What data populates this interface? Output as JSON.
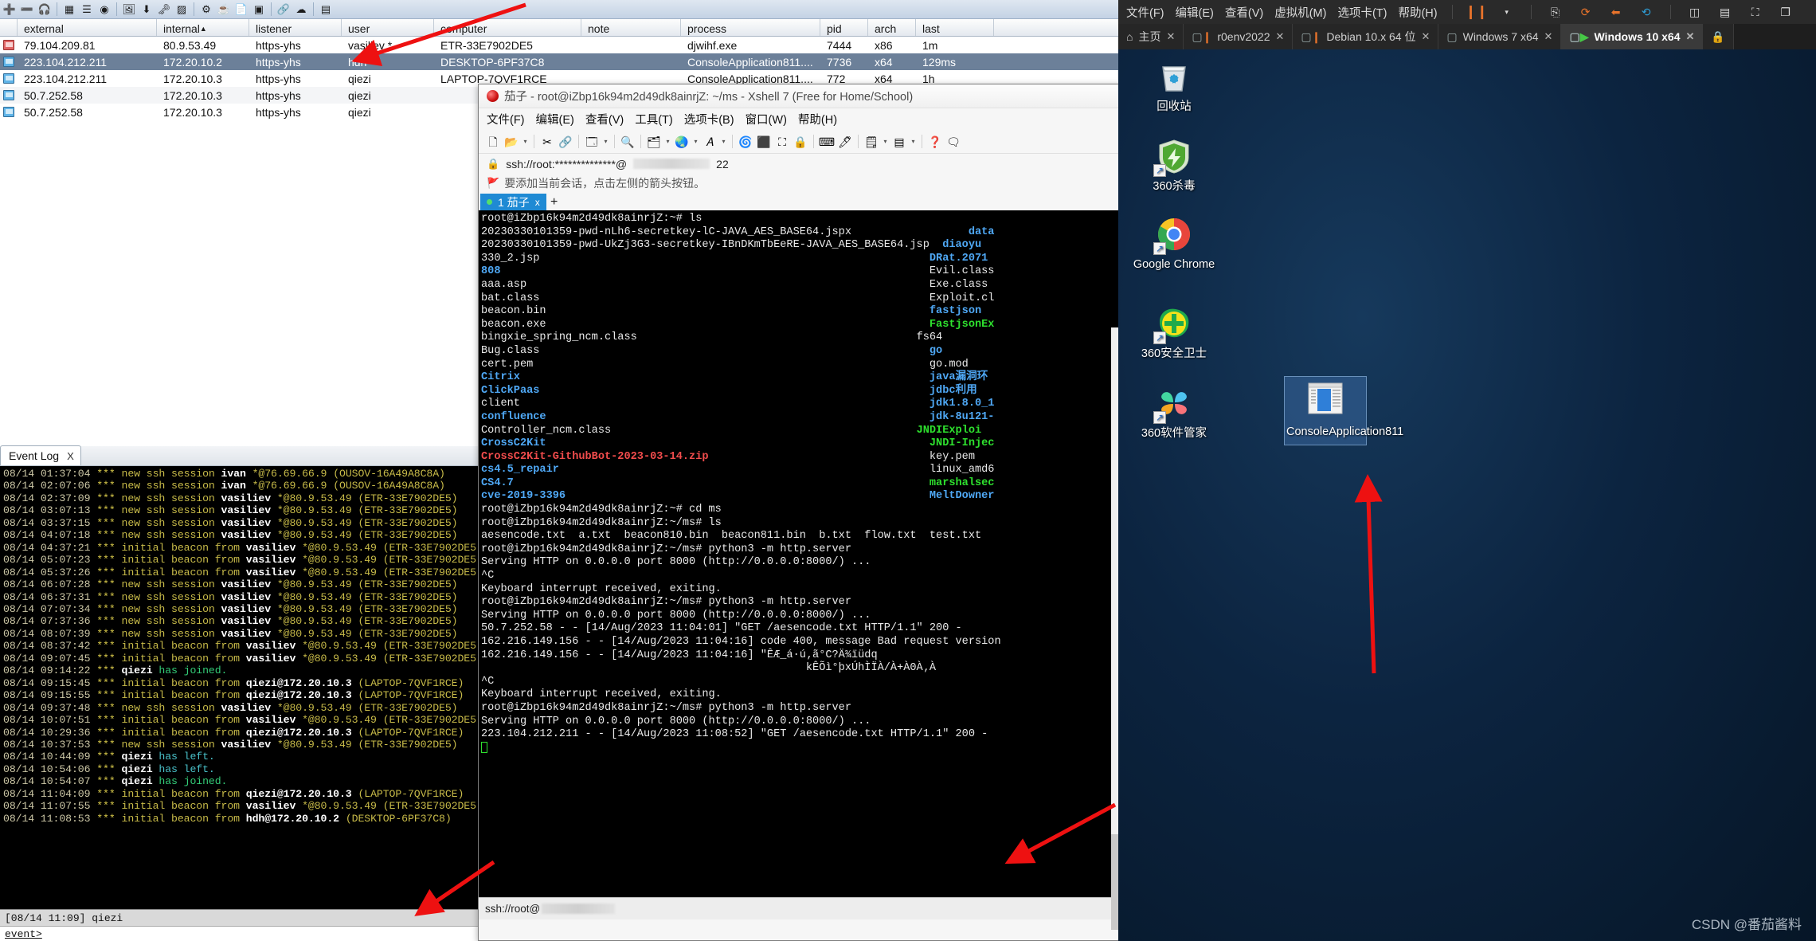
{
  "cobalt_strike": {
    "toolbar_icons": [
      "new-connection-icon",
      "disconnect-icon",
      "listeners-icon",
      "change-view-icon",
      "targets-icon",
      "crosshair-icon",
      "payload-icon",
      "download-icon",
      "credentials-icon",
      "screenshot-icon",
      "settings-icon",
      "java-icon",
      "script-icon",
      "console-icon",
      "link-icon",
      "cloud-icon",
      "help-icon"
    ],
    "table": {
      "columns": [
        "external",
        "internal",
        "listener",
        "user",
        "computer",
        "note",
        "process",
        "pid",
        "arch",
        "last"
      ],
      "sort_column": "internal",
      "rows": [
        {
          "external": "79.104.209.81",
          "internal": "80.9.53.49",
          "listener": "https-yhs",
          "user": "vasiliev *",
          "computer": "ETR-33E7902DE5",
          "note": "",
          "process": "djwihf.exe",
          "pid": "7444",
          "arch": "x86",
          "last": "1m",
          "icon": "beacon-red",
          "selected": false
        },
        {
          "external": "223.104.212.211",
          "internal": "172.20.10.2",
          "listener": "https-yhs",
          "user": "hdh",
          "computer": "DESKTOP-6PF37C8",
          "note": "",
          "process": "ConsoleApplication811....",
          "pid": "7736",
          "arch": "x64",
          "last": "129ms",
          "icon": "beacon-blue",
          "selected": true
        },
        {
          "external": "223.104.212.211",
          "internal": "172.20.10.3",
          "listener": "https-yhs",
          "user": "qiezi",
          "computer": "LAPTOP-7QVF1RCE",
          "note": "",
          "process": "ConsoleApplication811....",
          "pid": "772",
          "arch": "x64",
          "last": "1h",
          "icon": "beacon-blue",
          "selected": false
        },
        {
          "external": "50.7.252.58",
          "internal": "172.20.10.3",
          "listener": "https-yhs",
          "user": "qiezi",
          "computer": "",
          "note": "",
          "process": "",
          "pid": "",
          "arch": "",
          "last": "",
          "icon": "beacon-blue",
          "selected": false
        },
        {
          "external": "50.7.252.58",
          "internal": "172.20.10.3",
          "listener": "https-yhs",
          "user": "qiezi",
          "computer": "",
          "note": "",
          "process": "",
          "pid": "",
          "arch": "",
          "last": "",
          "icon": "beacon-blue",
          "selected": false
        }
      ]
    },
    "event_log": {
      "tab_label": "Event Log",
      "tab_close": "X",
      "lines": [
        {
          "ts": "08/14 01:37:04",
          "stars": "***",
          "text": " new ssh session ",
          "name": "ivan",
          "rest": " *@76.69.66.9 (OUSOV-16A49A8C8A)",
          "kind": "beacon"
        },
        {
          "ts": "08/14 02:07:06",
          "stars": "***",
          "text": " new ssh session ",
          "name": "ivan",
          "rest": " *@76.69.66.9 (OUSOV-16A49A8C8A)",
          "kind": "beacon"
        },
        {
          "ts": "08/14 02:37:09",
          "stars": "***",
          "text": " new ssh session ",
          "name": "vasiliev",
          "rest": " *@80.9.53.49 (ETR-33E7902DE5)",
          "kind": "beacon"
        },
        {
          "ts": "08/14 03:07:13",
          "stars": "***",
          "text": " new ssh session ",
          "name": "vasiliev",
          "rest": " *@80.9.53.49 (ETR-33E7902DE5)",
          "kind": "beacon"
        },
        {
          "ts": "08/14 03:37:15",
          "stars": "***",
          "text": " new ssh session ",
          "name": "vasiliev",
          "rest": " *@80.9.53.49 (ETR-33E7902DE5)",
          "kind": "beacon"
        },
        {
          "ts": "08/14 04:07:18",
          "stars": "***",
          "text": " new ssh session ",
          "name": "vasiliev",
          "rest": " *@80.9.53.49 (ETR-33E7902DE5)",
          "kind": "beacon"
        },
        {
          "ts": "08/14 04:37:21",
          "stars": "***",
          "text": " initial beacon from ",
          "name": "vasiliev",
          "rest": " *@80.9.53.49 (ETR-33E7902DE5)",
          "kind": "beacon"
        },
        {
          "ts": "08/14 05:07:23",
          "stars": "***",
          "text": " initial beacon from ",
          "name": "vasiliev",
          "rest": " *@80.9.53.49 (ETR-33E7902DE5)",
          "kind": "beacon"
        },
        {
          "ts": "08/14 05:37:26",
          "stars": "***",
          "text": " initial beacon from ",
          "name": "vasiliev",
          "rest": " *@80.9.53.49 (ETR-33E7902DE5)",
          "kind": "beacon"
        },
        {
          "ts": "08/14 06:07:28",
          "stars": "***",
          "text": " new ssh session ",
          "name": "vasiliev",
          "rest": " *@80.9.53.49 (ETR-33E7902DE5)",
          "kind": "beacon"
        },
        {
          "ts": "08/14 06:37:31",
          "stars": "***",
          "text": " new ssh session ",
          "name": "vasiliev",
          "rest": " *@80.9.53.49 (ETR-33E7902DE5)",
          "kind": "beacon"
        },
        {
          "ts": "08/14 07:07:34",
          "stars": "***",
          "text": " new ssh session ",
          "name": "vasiliev",
          "rest": " *@80.9.53.49 (ETR-33E7902DE5)",
          "kind": "beacon"
        },
        {
          "ts": "08/14 07:37:36",
          "stars": "***",
          "text": " new ssh session ",
          "name": "vasiliev",
          "rest": " *@80.9.53.49 (ETR-33E7902DE5)",
          "kind": "beacon"
        },
        {
          "ts": "08/14 08:07:39",
          "stars": "***",
          "text": " new ssh session ",
          "name": "vasiliev",
          "rest": " *@80.9.53.49 (ETR-33E7902DE5)",
          "kind": "beacon"
        },
        {
          "ts": "08/14 08:37:42",
          "stars": "***",
          "text": " initial beacon from ",
          "name": "vasiliev",
          "rest": " *@80.9.53.49 (ETR-33E7902DE5)",
          "kind": "beacon"
        },
        {
          "ts": "08/14 09:07:45",
          "stars": "***",
          "text": " initial beacon from ",
          "name": "vasiliev",
          "rest": " *@80.9.53.49 (ETR-33E7902DE5)",
          "kind": "beacon"
        },
        {
          "ts": "08/14 09:14:22",
          "stars": "***",
          "text": " ",
          "name": "qiezi",
          "rest": " has joined.",
          "kind": "join"
        },
        {
          "ts": "08/14 09:15:45",
          "stars": "***",
          "text": " initial beacon from ",
          "name": "qiezi@172.20.10.3",
          "rest": " (LAPTOP-7QVF1RCE)",
          "kind": "beacon"
        },
        {
          "ts": "08/14 09:15:55",
          "stars": "***",
          "text": " initial beacon from ",
          "name": "qiezi@172.20.10.3",
          "rest": " (LAPTOP-7QVF1RCE)",
          "kind": "beacon"
        },
        {
          "ts": "08/14 09:37:48",
          "stars": "***",
          "text": " new ssh session ",
          "name": "vasiliev",
          "rest": " *@80.9.53.49 (ETR-33E7902DE5)",
          "kind": "beacon"
        },
        {
          "ts": "08/14 10:07:51",
          "stars": "***",
          "text": " initial beacon from ",
          "name": "vasiliev",
          "rest": " *@80.9.53.49 (ETR-33E7902DE5)",
          "kind": "beacon"
        },
        {
          "ts": "08/14 10:29:36",
          "stars": "***",
          "text": " initial beacon from ",
          "name": "qiezi@172.20.10.3",
          "rest": " (LAPTOP-7QVF1RCE)",
          "kind": "beacon"
        },
        {
          "ts": "08/14 10:37:53",
          "stars": "***",
          "text": " new ssh session ",
          "name": "vasiliev",
          "rest": " *@80.9.53.49 (ETR-33E7902DE5)",
          "kind": "beacon"
        },
        {
          "ts": "08/14 10:44:09",
          "stars": "***",
          "text": " ",
          "name": "qiezi",
          "rest": " has left.",
          "kind": "left"
        },
        {
          "ts": "08/14 10:54:06",
          "stars": "***",
          "text": " ",
          "name": "qiezi",
          "rest": " has left.",
          "kind": "left"
        },
        {
          "ts": "08/14 10:54:07",
          "stars": "***",
          "text": " ",
          "name": "qiezi",
          "rest": " has joined.",
          "kind": "join"
        },
        {
          "ts": "08/14 11:04:09",
          "stars": "***",
          "text": " initial beacon from ",
          "name": "qiezi@172.20.10.3",
          "rest": " (LAPTOP-7QVF1RCE)",
          "kind": "beacon"
        },
        {
          "ts": "08/14 11:07:55",
          "stars": "***",
          "text": " initial beacon from ",
          "name": "vasiliev",
          "rest": " *@80.9.53.49 (ETR-33E7902DE5)",
          "kind": "beacon"
        },
        {
          "ts": "08/14 11:08:53",
          "stars": "***",
          "text": " initial beacon from ",
          "name": "hdh@172.20.10.2",
          "rest": " (DESKTOP-6PF37C8)",
          "kind": "beacon"
        }
      ],
      "status_line": "[08/14 11:09] qiezi",
      "prompt": "event>"
    }
  },
  "xshell": {
    "title": "茄子 - root@iZbp16k94m2d49dk8ainrjZ: ~/ms - Xshell 7 (Free for Home/School)",
    "menu": [
      "文件(F)",
      "编辑(E)",
      "查看(V)",
      "工具(T)",
      "选项卡(B)",
      "窗口(W)",
      "帮助(H)"
    ],
    "address_prefix": "ssh://root:**************@",
    "address_port": "22",
    "hint": "要添加当前会话，点击左侧的箭头按钮。",
    "tab_label": "1 茄子",
    "tab_close": "x",
    "new_tab": "+",
    "status_prefix": "ssh://root@",
    "terminal": [
      [
        {
          "t": "root@iZbp16k94m2d49dk8ainrjZ:~# ls",
          "c": "w"
        }
      ],
      [
        {
          "t": "20230330101359-pwd-nLh6-secretkey-lC-JAVA_AES_BASE64.jspx",
          "c": "w"
        },
        {
          "t": "                  ",
          "c": "w"
        },
        {
          "t": "data",
          "c": "b"
        }
      ],
      [
        {
          "t": "20230330101359-pwd-UkZj3G3-secretkey-IBnDKmTbEeRE-JAVA_AES_BASE64.jsp",
          "c": "w"
        },
        {
          "t": "  ",
          "c": "w"
        },
        {
          "t": "diaoyu",
          "c": "b"
        }
      ],
      [
        {
          "t": "330_2.jsp",
          "c": "w"
        },
        {
          "t": "                                                            ",
          "c": "w"
        },
        {
          "t": "DRat.2071",
          "c": "b"
        }
      ],
      [
        {
          "t": "808",
          "c": "b"
        },
        {
          "t": "                                                                  ",
          "c": "w"
        },
        {
          "t": "Evil.class",
          "c": "w"
        }
      ],
      [
        {
          "t": "aaa.asp",
          "c": "w"
        },
        {
          "t": "                                                              ",
          "c": "w"
        },
        {
          "t": "Exe.class",
          "c": "w"
        }
      ],
      [
        {
          "t": "bat.class",
          "c": "w"
        },
        {
          "t": "                                                            ",
          "c": "w"
        },
        {
          "t": "Exploit.cl",
          "c": "w"
        }
      ],
      [
        {
          "t": "beacon.bin",
          "c": "w"
        },
        {
          "t": "                                                           ",
          "c": "w"
        },
        {
          "t": "fastjson",
          "c": "b"
        }
      ],
      [
        {
          "t": "beacon.exe",
          "c": "w"
        },
        {
          "t": "                                                           ",
          "c": "w"
        },
        {
          "t": "FastjsonEx",
          "c": "g"
        }
      ],
      [
        {
          "t": "bingxie_spring_ncm.class",
          "c": "w"
        },
        {
          "t": "                                           ",
          "c": "w"
        },
        {
          "t": "fs64",
          "c": "w"
        }
      ],
      [
        {
          "t": "Bug.class",
          "c": "w"
        },
        {
          "t": "                                                            ",
          "c": "w"
        },
        {
          "t": "go",
          "c": "b"
        }
      ],
      [
        {
          "t": "cert.pem",
          "c": "w"
        },
        {
          "t": "                                                             ",
          "c": "w"
        },
        {
          "t": "go.mod",
          "c": "w"
        }
      ],
      [
        {
          "t": "Citrix",
          "c": "b"
        },
        {
          "t": "                                                               ",
          "c": "w"
        },
        {
          "t": "java漏洞环",
          "c": "b"
        }
      ],
      [
        {
          "t": "ClickPaas",
          "c": "b"
        },
        {
          "t": "                                                            ",
          "c": "w"
        },
        {
          "t": "jdbc利用",
          "c": "b"
        }
      ],
      [
        {
          "t": "client",
          "c": "w"
        },
        {
          "t": "                                                               ",
          "c": "w"
        },
        {
          "t": "jdk1.8.0_1",
          "c": "b"
        }
      ],
      [
        {
          "t": "confluence",
          "c": "b"
        },
        {
          "t": "                                                           ",
          "c": "w"
        },
        {
          "t": "jdk-8u121-",
          "c": "b"
        }
      ],
      [
        {
          "t": "Controller_ncm.class",
          "c": "w"
        },
        {
          "t": "                                               ",
          "c": "w"
        },
        {
          "t": "JNDIExploi",
          "c": "g"
        }
      ],
      [
        {
          "t": "CrossC2Kit",
          "c": "b"
        },
        {
          "t": "                                                           ",
          "c": "w"
        },
        {
          "t": "JNDI-Injec",
          "c": "g"
        }
      ],
      [
        {
          "t": "CrossC2Kit-GithubBot-2023-03-14.zip",
          "c": "r"
        },
        {
          "t": "                                  ",
          "c": "w"
        },
        {
          "t": "key.pem",
          "c": "w"
        }
      ],
      [
        {
          "t": "cs4.5_repair",
          "c": "b"
        },
        {
          "t": "                                                         ",
          "c": "w"
        },
        {
          "t": "linux_amd6",
          "c": "w"
        }
      ],
      [
        {
          "t": "CS4.7",
          "c": "b"
        },
        {
          "t": "                                                                ",
          "c": "w"
        },
        {
          "t": "marshalsec",
          "c": "g"
        }
      ],
      [
        {
          "t": "cve-2019-3396",
          "c": "b"
        },
        {
          "t": "                                                        ",
          "c": "w"
        },
        {
          "t": "MeltDowner",
          "c": "b"
        }
      ],
      [
        {
          "t": "root@iZbp16k94m2d49dk8ainrjZ:~# cd ms",
          "c": "w"
        }
      ],
      [
        {
          "t": "root@iZbp16k94m2d49dk8ainrjZ:~/ms# ls",
          "c": "w"
        }
      ],
      [
        {
          "t": "aesencode.txt  a.txt  beacon810.bin  beacon811.bin  b.txt  flow.txt  test.txt",
          "c": "w"
        }
      ],
      [
        {
          "t": "root@iZbp16k94m2d49dk8ainrjZ:~/ms# python3 -m http.server",
          "c": "w"
        }
      ],
      [
        {
          "t": "Serving HTTP on 0.0.0.0 port 8000 (http://0.0.0.0:8000/) ...",
          "c": "w"
        }
      ],
      [
        {
          "t": "^C",
          "c": "w"
        }
      ],
      [
        {
          "t": "Keyboard interrupt received, exiting.",
          "c": "w"
        }
      ],
      [
        {
          "t": "root@iZbp16k94m2d49dk8ainrjZ:~/ms# python3 -m http.server",
          "c": "w"
        }
      ],
      [
        {
          "t": "Serving HTTP on 0.0.0.0 port 8000 (http://0.0.0.0:8000/) ...",
          "c": "w"
        }
      ],
      [
        {
          "t": "50.7.252.58 - - [14/Aug/2023 11:04:01] \"GET /aesencode.txt HTTP/1.1\" 200 -",
          "c": "w"
        }
      ],
      [
        {
          "t": "162.216.149.156 - - [14/Aug/2023 11:04:16] code 400, message Bad request version",
          "c": "w"
        }
      ],
      [
        {
          "t": "162.216.149.156 - - [14/Aug/2023 11:04:16] \"ÊÆ_á·ú‚ã°C?Ä¾ïüdq",
          "c": "w"
        }
      ],
      [
        {
          "t": "                                                  kÊÕì°þxÚhÌÏÀ/À+À0À‚À",
          "c": "w"
        }
      ],
      [
        {
          "t": "^C",
          "c": "w"
        }
      ],
      [
        {
          "t": "Keyboard interrupt received, exiting.",
          "c": "w"
        }
      ],
      [
        {
          "t": "root@iZbp16k94m2d49dk8ainrjZ:~/ms# python3 -m http.server",
          "c": "w"
        }
      ],
      [
        {
          "t": "Serving HTTP on 0.0.0.0 port 8000 (http://0.0.0.0:8000/) ...",
          "c": "w"
        }
      ],
      [
        {
          "t": "223.104.212.211 - - [14/Aug/2023 11:08:52] \"GET /aesencode.txt HTTP/1.1\" 200 -",
          "c": "w"
        }
      ]
    ]
  },
  "vmware": {
    "menu": [
      "文件(F)",
      "编辑(E)",
      "查看(V)",
      "虚拟机(M)",
      "选项卡(T)",
      "帮助(H)"
    ],
    "toolbar_icons": [
      "pause-icon",
      "dropdown-caret-icon",
      "snapshot-icon",
      "snapshot-take-icon",
      "snapshot-revert-icon",
      "snapshot-manager-icon",
      "layout-a-icon",
      "layout-b-icon",
      "layout-c-icon",
      "layout-d-icon",
      "fullscreen-icon",
      "unity-icon"
    ],
    "tabs": [
      {
        "label": "主页",
        "icon": "home-icon",
        "active": false
      },
      {
        "label": "r0env2022",
        "icon": "vm-paused-icon",
        "active": false
      },
      {
        "label": "Debian 10.x 64 位",
        "icon": "vm-paused-icon",
        "active": false
      },
      {
        "label": "Windows 7 x64",
        "icon": "vm-stopped-icon",
        "active": false
      },
      {
        "label": "Windows 10 x64",
        "icon": "vm-running-icon",
        "active": true
      }
    ],
    "desktop_icons": [
      {
        "label": "回收站",
        "icon": "recycle-bin-icon",
        "shortcut": false,
        "selected": false
      },
      {
        "label": "360杀毒",
        "icon": "360-antivirus-icon",
        "shortcut": true,
        "selected": false
      },
      {
        "label": "Google Chrome",
        "icon": "chrome-icon",
        "shortcut": true,
        "selected": false
      },
      {
        "label": "360安全卫士",
        "icon": "360-safe-icon",
        "shortcut": true,
        "selected": false
      },
      {
        "label": "360软件管家",
        "icon": "360-software-icon",
        "shortcut": true,
        "selected": false
      },
      {
        "label": "ConsoleApplication811",
        "icon": "console-app-icon",
        "shortcut": false,
        "selected": true
      }
    ],
    "watermark": "CSDN @番茄酱料"
  }
}
